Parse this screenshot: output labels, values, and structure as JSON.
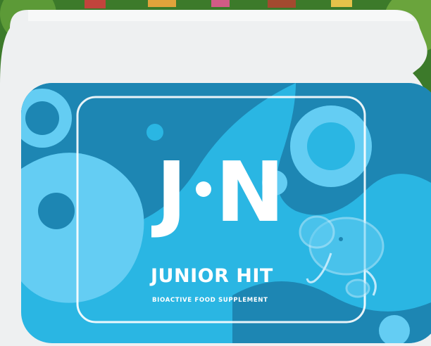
{
  "product": {
    "brand_left": "J",
    "brand_right": "N",
    "name": "JUNIOR HIT",
    "subtitle": "BIOACTIVE FOOD SUPPLEMENT"
  },
  "colors": {
    "background_foliage": "#3c7a2a",
    "container_white": "#eef0f1",
    "label_light_blue": "#2ab6e3",
    "label_dark_blue": "#1d86b3",
    "label_pale_blue": "#64cdf3",
    "text_white": "#ffffff"
  },
  "icons": {
    "mascot": "elephant-icon"
  }
}
